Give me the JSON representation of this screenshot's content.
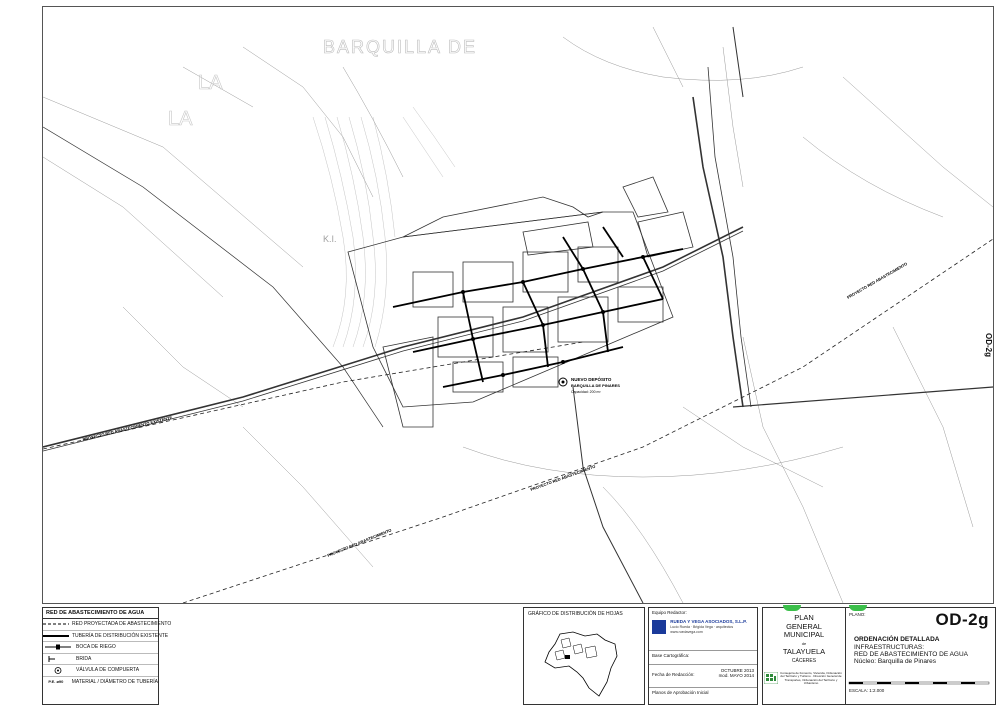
{
  "map": {
    "place_labels": [
      "BARQUILLA DE",
      "LA",
      "K.I.",
      "LA"
    ],
    "road_labels": [
      "PROYECTO RED ABASTECIMIENTO EXISTENTE",
      "PROYECTO RED ABASTECIMIENTO",
      "PROYECTO RED ABASTECIMIENTO",
      "PROYECTO RED ABASTECIMIENTO"
    ],
    "deposit_label": {
      "title": "NUEVO DEPÓSITO",
      "name": "BARQUILLA DE PINARES",
      "capacity": "Capacidad: 200 m³"
    },
    "side_code": "OD-2g"
  },
  "legend": {
    "title": "RED DE ABASTECIMIENTO DE AGUA",
    "items": [
      {
        "symbol": "dashed-line",
        "label": "RED PROYECTADA DE ABASTECIMIENTO"
      },
      {
        "symbol": "solid-line",
        "label": "TUBERÍA DE DISTRIBUCIÓN EXISTENTE"
      },
      {
        "symbol": "valve-line",
        "label": "BOCA DE RIEGO"
      },
      {
        "symbol": "brida",
        "label": "BRIDA"
      },
      {
        "symbol": "valve-circle",
        "label": "VÁLVULA DE COMPUERTA"
      },
      {
        "symbol": "text-symbol",
        "symbol_text": "P.E. ø90",
        "label": "MATERIAL / DIÁMETRO DE TUBERÍA"
      }
    ]
  },
  "sheets": {
    "title": "GRÁFICO DE DISTRIBUCIÓN DE HOJAS"
  },
  "credits": {
    "equipo_label": "Equipo Redactor:",
    "firm": "RUEDA Y VEGA ASOCIADOS, S.L.P.",
    "firm_sub1": "Lucio Rueda · Brigida Vega · arquitectos",
    "firm_sub2": "www.ruedavega.com",
    "base_label": "Base Cartográfica:",
    "fecha_label": "Fecha de Redacción:",
    "fecha_value_1": "OCTUBRE 2013",
    "fecha_value_2": "mod. MAYO 2014",
    "planos_label": "Planos de Aprobación Inicial"
  },
  "title_block": {
    "plan_line1": "PLAN",
    "plan_line2": "GENERAL",
    "plan_line3": "MUNICIPAL",
    "de": "de",
    "municipality": "TALAYUELA",
    "province": "CÁCERES",
    "plano_label": "PLANO:",
    "code": "OD-2g",
    "title1": "ORDENACIÓN DETALLADA",
    "title2": "INFRAESTRUCTURAS:",
    "title3": "RED DE ABASTECIMIENTO DE AGUA",
    "title4": "Núcleo: Barquilla de Pinares",
    "escala_label": "ESCALA:",
    "escala_value": "1:2.000",
    "fund_text": "Consejería de Fomento, Vivienda, Ordenación del Territorio y Turismo · Dirección General de Transportes, Ordenación del Territorio y Urbanismo"
  }
}
